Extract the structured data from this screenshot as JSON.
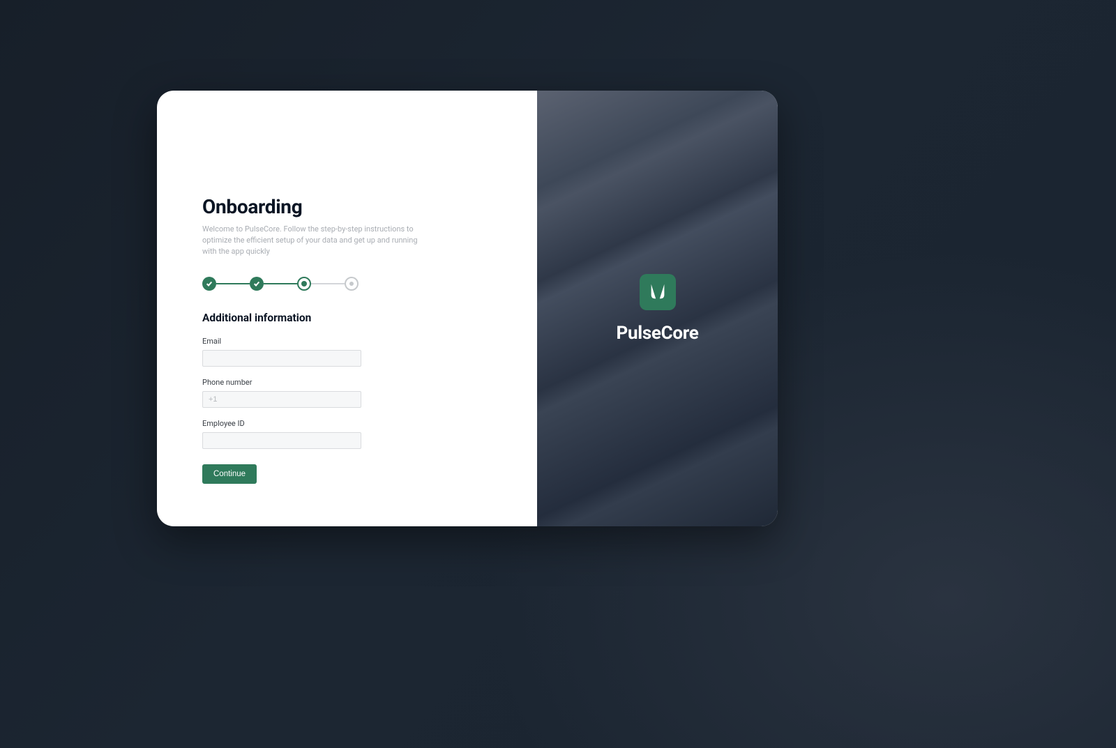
{
  "page": {
    "title": "Onboarding",
    "subtitle": "Welcome to PulseCore. Follow the step-by-step instructions to optimize the efficient setup of your data and get up and running with the app quickly"
  },
  "stepper": {
    "steps": [
      {
        "state": "done"
      },
      {
        "state": "done"
      },
      {
        "state": "current"
      },
      {
        "state": "upcoming"
      }
    ]
  },
  "section": {
    "title": "Additional information"
  },
  "form": {
    "email": {
      "label": "Email",
      "value": "",
      "placeholder": ""
    },
    "phone": {
      "label": "Phone number",
      "value": "",
      "placeholder": "+1"
    },
    "employee_id": {
      "label": "Employee ID",
      "value": "",
      "placeholder": ""
    },
    "continue_label": "Continue"
  },
  "brand": {
    "name": "PulseCore"
  },
  "colors": {
    "accent": "#2f7a5b",
    "bg_dark": "#1a2430"
  }
}
